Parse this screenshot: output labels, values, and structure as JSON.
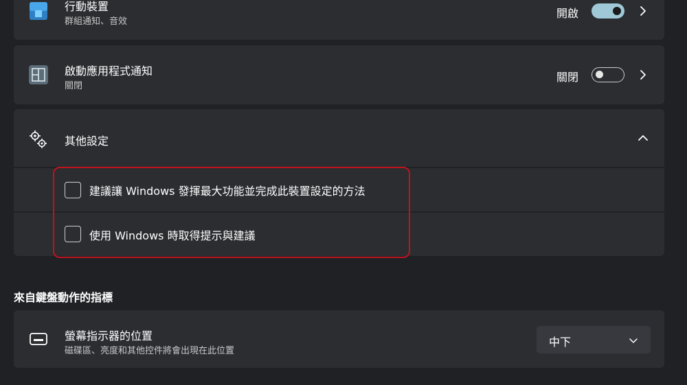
{
  "rows": {
    "mobile_device": {
      "title": "行動裝置",
      "subtitle": "群組通知、音效",
      "state": "開啟",
      "toggle_on": true,
      "icon": "mobile-device-icon"
    },
    "startup_apps": {
      "title": "啟動應用程式通知",
      "subtitle": "關閉",
      "state": "關閉",
      "toggle_on": false,
      "icon": "startup-apps-icon"
    }
  },
  "other_settings": {
    "title": "其他設定",
    "icon": "gears-icon",
    "expanded": true,
    "options": [
      {
        "label": "建議讓 Windows 發揮最大功能並完成此裝置設定的方法",
        "checked": false
      },
      {
        "label": "使用 Windows 時取得提示與建議",
        "checked": false
      }
    ]
  },
  "keyboard_section": {
    "heading": "來自鍵盤動作的指標",
    "indicator_position": {
      "title": "螢幕指示器的位置",
      "subtitle": "磁碟區、亮度和其他控件將會出現在此位置",
      "icon": "screen-indicator-icon",
      "selected": "中下"
    }
  },
  "colors": {
    "background": "#1f2125",
    "card": "#2b2d31",
    "toggle_on": "#9fc9d6",
    "highlight": "#c0141d"
  }
}
